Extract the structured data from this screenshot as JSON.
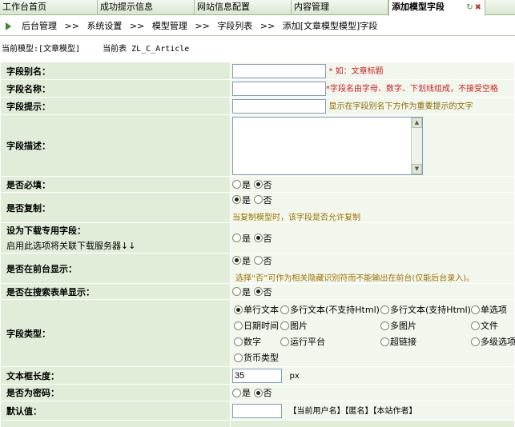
{
  "tabs": [
    {
      "label": "工作台首页"
    },
    {
      "label": "成功提示信息"
    },
    {
      "label": "网站信息配置"
    },
    {
      "label": "内容管理"
    },
    {
      "label": "添加模型字段"
    }
  ],
  "breadcrumb": {
    "items": [
      "后台管理",
      "系统设置",
      "模型管理",
      "字段列表",
      "添加[文章模型模型]字段"
    ],
    "sep": ">>"
  },
  "model_info": {
    "current_model": "当前模型:[文章模型]",
    "current_table": "当前表 ZL_C_Article"
  },
  "form": {
    "alias": {
      "label": "字段别名：",
      "hint": "* 如：文章标题"
    },
    "name": {
      "label": "字段名称：",
      "hint": "*字段名由字母、数字、下划线组成，不接受空格"
    },
    "tip": {
      "label": "字段提示：",
      "hint": "显示在字段别名下方作为重要提示的文字"
    },
    "desc": {
      "label": "字段描述："
    },
    "required": {
      "label": "是否必填：",
      "yes": "是",
      "no": "否"
    },
    "copy": {
      "label": "是否复制：",
      "yes": "是",
      "no": "否",
      "hint": "当复制模型时，该字段是否允许复制"
    },
    "download": {
      "label": "设为下载专用字段：",
      "sub": "启用此选项将关联下载服务器↓↓",
      "yes": "是",
      "no": "否"
    },
    "front": {
      "label": "是否在前台显示：",
      "yes": "是",
      "no": "否",
      "hint": "选择“否”可作为相关隐藏识别符而不能输出在前台(仅能后台录入)。"
    },
    "search": {
      "label": "是否在搜索表单显示：",
      "yes": "是",
      "no": "否"
    },
    "type": {
      "label": "字段类型：",
      "options": [
        "单行文本",
        "多行文本(不支持Html)",
        "多行文本(支持Html)",
        "单选项",
        "日期时间",
        "图片",
        "多图片",
        "文件",
        "数字",
        "运行平台",
        "超链接",
        "多级选项",
        "货币类型"
      ]
    },
    "length": {
      "label": "文本框长度：",
      "value": "35",
      "unit": "px"
    },
    "password": {
      "label": "是否为密码：",
      "yes": "是",
      "no": "否"
    },
    "default": {
      "label": "默认值：",
      "links": "【当前用户名】【匿名】【本站作者】"
    }
  }
}
